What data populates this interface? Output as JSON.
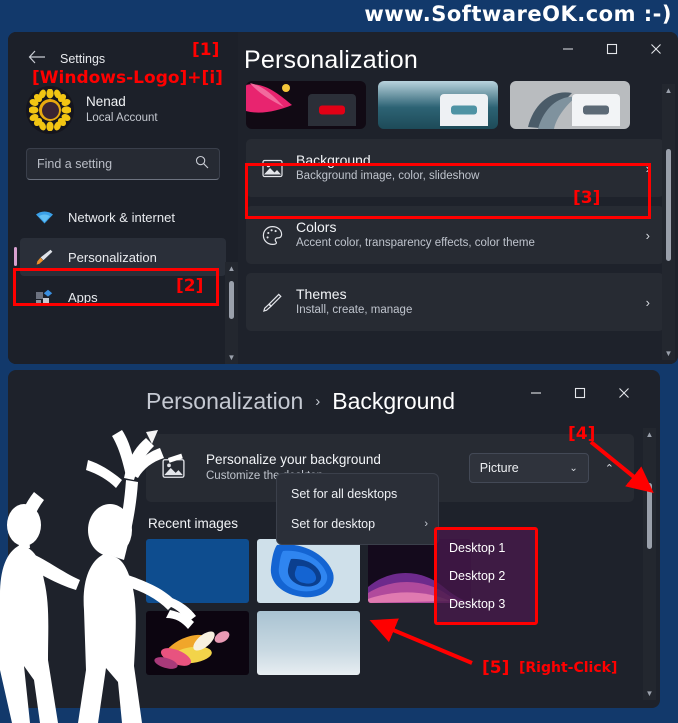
{
  "watermark": "www.SoftwareOK.com :-)",
  "settings_window": {
    "nav": {
      "back_icon": "back-arrow-icon",
      "title": "Settings",
      "account": {
        "name": "Nenad",
        "type": "Local Account",
        "avatar": "sunflower-avatar"
      },
      "search": {
        "placeholder": "Find a setting",
        "icon": "search-icon"
      },
      "items": [
        {
          "label": "Network & internet",
          "icon": "wifi-icon",
          "selected": false
        },
        {
          "label": "Personalization",
          "icon": "paintbrush-icon",
          "selected": true
        },
        {
          "label": "Apps",
          "icon": "apps-icon",
          "selected": false
        }
      ]
    },
    "page_title": "Personalization",
    "theme_cards": [
      {
        "name": "dark-theme-preview"
      },
      {
        "name": "light-blue-theme-preview"
      },
      {
        "name": "gray-theme-preview"
      }
    ],
    "settings_cards": [
      {
        "title": "Background",
        "subtitle": "Background image, color, slideshow",
        "icon": "image-icon",
        "chevron": "›"
      },
      {
        "title": "Colors",
        "subtitle": "Accent color, transparency effects, color theme",
        "icon": "palette-icon",
        "chevron": "›"
      },
      {
        "title": "Themes",
        "subtitle": "Install, create, manage",
        "icon": "brush-icon",
        "chevron": "›"
      }
    ],
    "window_controls": {
      "minimize": "–",
      "maximize": "□",
      "close": "✕"
    }
  },
  "background_window": {
    "breadcrumb": {
      "parent": "Personalization",
      "separator": "›",
      "current": "Background"
    },
    "personalize": {
      "title": "Personalize your background",
      "subtitle": "Customize the desktop",
      "icon": "image-icon",
      "dropdown_value": "Picture",
      "dropdown_chevron": "⌄",
      "expander_chevron": "⌃"
    },
    "recent_images_label": "Recent images",
    "thumbnails": [
      {
        "name": "thumb-solid-blue"
      },
      {
        "name": "thumb-win11-bloom-blue"
      },
      {
        "name": "thumb-purple-abstract"
      },
      {
        "name": "thumb-dark-flower"
      },
      {
        "name": "thumb-light-sky"
      }
    ],
    "window_controls": {
      "minimize": "–",
      "maximize": "□",
      "close": "✕"
    }
  },
  "context_menu": {
    "items": [
      {
        "label": "Set for all desktops",
        "has_submenu": false
      },
      {
        "label": "Set for desktop",
        "has_submenu": true,
        "submenu_chevron": "›"
      }
    ],
    "submenu_items": [
      {
        "label": "Desktop 1"
      },
      {
        "label": "Desktop 2"
      },
      {
        "label": "Desktop 3"
      }
    ]
  },
  "annotations": {
    "step1": "[1]",
    "shortcut": "[Windows-Logo]+[i]",
    "step2": "[2]",
    "step3": "[3]",
    "step4": "[4]",
    "step5": "[5]",
    "right_click": "[Right-Click]"
  },
  "colors": {
    "desktop_blue": "#12396b",
    "window_bg": "#1e222b",
    "card_bg": "#272b33",
    "annotation_red": "#ff0000",
    "accent_pink": "#d8a0cf"
  }
}
